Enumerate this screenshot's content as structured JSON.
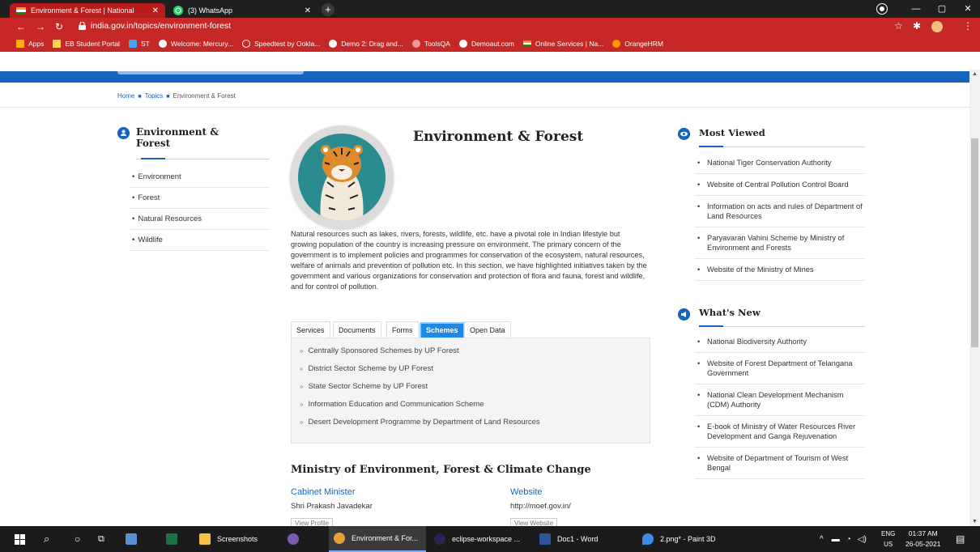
{
  "browser": {
    "tabs": [
      {
        "title": "Environment & Forest | National"
      },
      {
        "title": "(3) WhatsApp"
      }
    ],
    "url": "india.gov.in/topics/environment-forest",
    "bookmarks": [
      {
        "label": "Apps"
      },
      {
        "label": "EB Student Portal"
      },
      {
        "label": "ST"
      },
      {
        "label": "Welcome: Mercury..."
      },
      {
        "label": "Speedtest by Ookla..."
      },
      {
        "label": "Demo 2: Drag and..."
      },
      {
        "label": "ToolsQA"
      },
      {
        "label": "Demoaut.com"
      },
      {
        "label": "Online Services | Na..."
      },
      {
        "label": "OrangeHRM"
      }
    ]
  },
  "breadcrumb": [
    "Home",
    "Topics",
    "Environment & Forest"
  ],
  "sidebar": {
    "title": "Environment & Forest",
    "items": [
      "Environment",
      "Forest",
      "Natural Resources",
      "Wildlife"
    ]
  },
  "main": {
    "title": "Environment & Forest",
    "intro": "Natural resources such as lakes, rivers, forests, wildlife, etc. have a pivotal role in Indian lifestyle but growing population of the country is increasing pressure on environment. The primary concern of the government is to implement policies and programmes for conservation of the ecosystem, natural resources, welfare of animals and prevention of pollution etc. In this section, we have highlighted initiatives taken by the government and various organizations for conservation and protection of flora and fauna, forest and wildlife, and for control of pollution.",
    "tabs": [
      "Services",
      "Documents",
      "Forms",
      "Schemes",
      "Open Data"
    ],
    "active_tab": "Schemes",
    "schemes": [
      "Centrally Sponsored Schemes by UP Forest",
      "District Sector Scheme by UP Forest",
      "State Sector Scheme by UP Forest",
      "Information Education and Communication Scheme",
      "Desert Development Programme by Department of Land Resources"
    ],
    "ministry": {
      "title": "Ministry of Environment, Forest & Climate Change",
      "cabinet_label": "Cabinet Minister",
      "cabinet_name": "Shri Prakash Javadekar",
      "view_profile": "View Profile",
      "website_label": "Website",
      "website_url": "http://moef.gov.in/",
      "view_website": "View Website"
    }
  },
  "most_viewed": {
    "title": "Most Viewed",
    "items": [
      "National Tiger Conservation Authority",
      "Website of Central Pollution Control Board",
      "Information on acts and rules of Department of Land Resources",
      "Paryavaran Vahini Scheme by Ministry of Environment and Forests",
      "Website of the Ministry of Mines"
    ]
  },
  "whats_new": {
    "title": "What's New",
    "items": [
      "National Biodiversity Authority",
      "Website of Forest Department of Telangana Government",
      "National Clean Development Mechanism (CDM) Authority",
      "E-book of Ministry of Water Resources River Development and Ganga Rejuvenation",
      "Website of Department of Tourism of West Bengal"
    ]
  },
  "taskbar": {
    "apps": [
      {
        "label": "Screenshots"
      },
      {
        "label": "Environment & For..."
      },
      {
        "label": "eclipse-workspace ..."
      },
      {
        "label": "Doc1 - Word"
      },
      {
        "label": "2.png* - Paint 3D"
      }
    ],
    "lang": "ENG",
    "region": "US",
    "time": "01:37 AM",
    "date": "26-05-2021"
  },
  "colors": {
    "brand_red": "#c62828",
    "link_blue": "#1565c0",
    "active_tab": "#1e88e5"
  }
}
